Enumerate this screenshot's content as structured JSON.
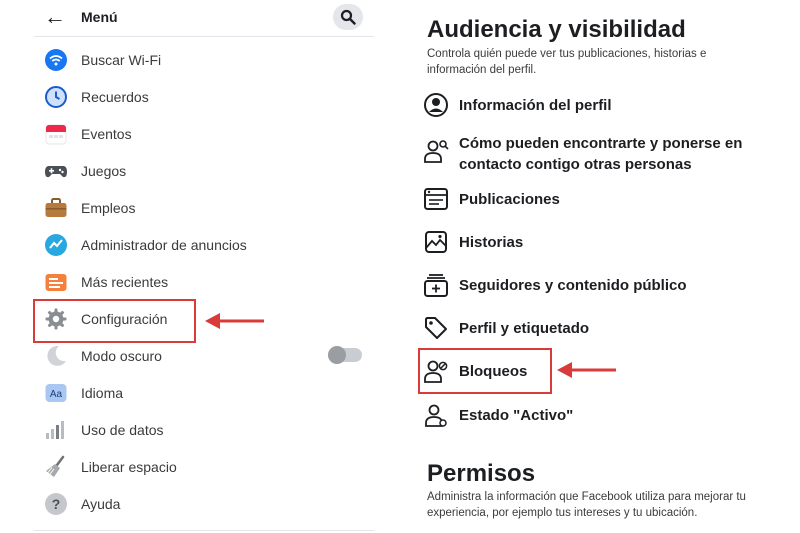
{
  "left_menu": {
    "back_label": "←",
    "title": "Menú",
    "items": [
      {
        "label": "Buscar Wi-Fi",
        "icon": "wifi-icon"
      },
      {
        "label": "Recuerdos",
        "icon": "clock-icon"
      },
      {
        "label": "Eventos",
        "icon": "calendar-icon"
      },
      {
        "label": "Juegos",
        "icon": "gamepad-icon"
      },
      {
        "label": "Empleos",
        "icon": "briefcase-icon"
      },
      {
        "label": "Administrador de anuncios",
        "icon": "ads-manager-icon"
      },
      {
        "label": "Más recientes",
        "icon": "feed-icon"
      },
      {
        "label": "Configuración",
        "icon": "gear-icon",
        "highlighted": true
      },
      {
        "label": "Modo oscuro",
        "icon": "moon-icon",
        "toggle": false
      },
      {
        "label": "Idioma",
        "icon": "language-icon"
      },
      {
        "label": "Uso de datos",
        "icon": "data-usage-icon"
      },
      {
        "label": "Liberar espacio",
        "icon": "broom-icon"
      },
      {
        "label": "Ayuda",
        "icon": "help-icon"
      }
    ]
  },
  "audience": {
    "title": "Audiencia y visibilidad",
    "description": "Controla quién puede ver tus publicaciones, historias e información del perfil.",
    "items": [
      {
        "line1": "Información del perfil",
        "icon": "profile-info-icon"
      },
      {
        "line1": "Cómo pueden encontrarte y ponerse en",
        "line2": "contacto contigo otras personas",
        "icon": "find-contact-icon"
      },
      {
        "line1": "Publicaciones",
        "icon": "posts-icon"
      },
      {
        "line1": "Historias",
        "icon": "stories-icon"
      },
      {
        "line1": "Seguidores y contenido público",
        "icon": "followers-icon"
      },
      {
        "line1": "Perfil y etiquetado",
        "icon": "tag-icon"
      },
      {
        "line1": "Bloqueos",
        "icon": "block-user-icon",
        "highlighted": true
      },
      {
        "line1": "Estado \"Activo\"",
        "icon": "active-status-icon"
      }
    ]
  },
  "permissions": {
    "title": "Permisos",
    "description": "Administra la información que Facebook utiliza para mejorar tu experiencia, por ejemplo tus intereses y tu ubicación."
  },
  "colors": {
    "highlight": "#d93a3a",
    "accent": "#1877f2"
  }
}
